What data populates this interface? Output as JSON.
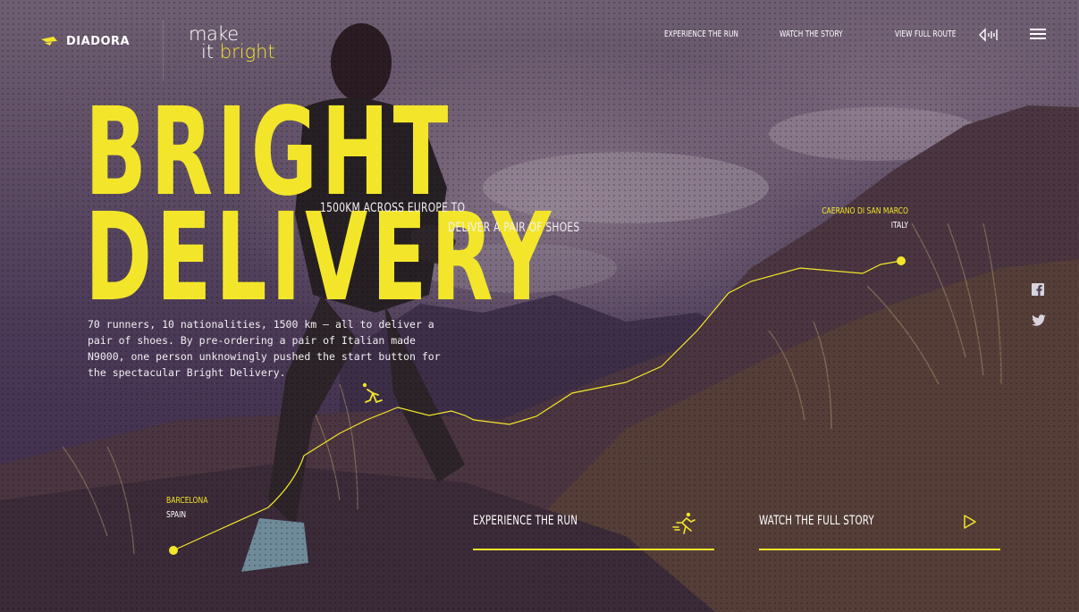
{
  "brand": {
    "name": "DIADORA",
    "tagline_line1": "make",
    "tagline_it": "it",
    "tagline_bright": "bright"
  },
  "nav": {
    "items": [
      "EXPERIENCE THE RUN",
      "WATCH THE STORY",
      "VIEW FULL ROUTE"
    ],
    "sound_icon": "sound-toggle-icon",
    "menu_icon": "hamburger-menu-icon"
  },
  "hero": {
    "title_line1": "BRIGHT",
    "title_line2": "DELIVERY",
    "subtitle_line1": "1500KM ACROSS EUROPE TO",
    "subtitle_line2": "DELIVER A PAIR OF SHOES",
    "description": "70 runners, 10 nationalities, 1500 km – all to deliver a pair of shoes. By pre-ordering a pair of Italian made N9000, one person unknowingly pushed the start button for the spectacular Bright Delivery."
  },
  "route": {
    "start": {
      "city": "BARCELONA",
      "country": "SPAIN"
    },
    "end": {
      "city": "CAERANO DI SAN MARCO",
      "country": "ITALY"
    }
  },
  "social": [
    "facebook-icon",
    "twitter-icon"
  ],
  "cta": {
    "run_label": "EXPERIENCE THE RUN",
    "story_label": "WATCH THE FULL STORY"
  },
  "colors": {
    "accent": "#f3e62a",
    "text": "#ffffff",
    "overlay": "#3a2a48"
  }
}
